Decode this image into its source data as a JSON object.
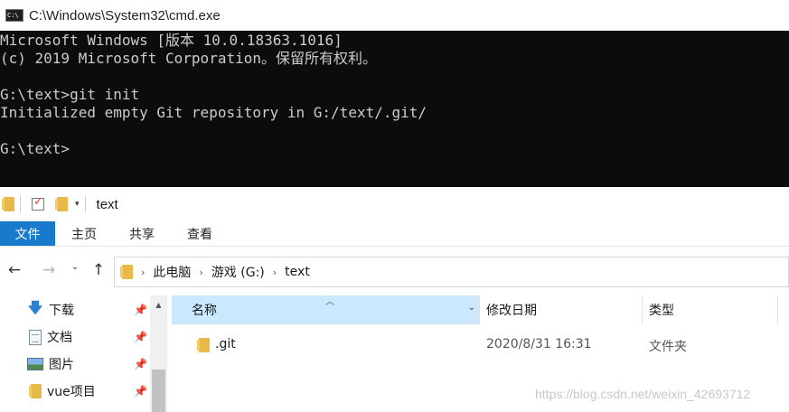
{
  "cmd": {
    "title": "C:\\Windows\\System32\\cmd.exe",
    "lines": [
      "Microsoft Windows [版本 10.0.18363.1016]",
      "(c) 2019 Microsoft Corporation。保留所有权利。",
      "",
      "G:\\text>git init",
      "Initialized empty Git repository in G:/text/.git/",
      "",
      "G:\\text>"
    ]
  },
  "explorer": {
    "window_title": "text",
    "ribbon_tabs": [
      "文件",
      "主页",
      "共享",
      "查看"
    ],
    "breadcrumb": [
      "此电脑",
      "游戏 (G:)",
      "text"
    ],
    "nav_items": [
      {
        "label": "下载",
        "icon": "download-arrow-icon"
      },
      {
        "label": "文档",
        "icon": "document-icon"
      },
      {
        "label": "图片",
        "icon": "pictures-icon"
      },
      {
        "label": "vue项目",
        "icon": "folder-icon"
      }
    ],
    "columns": {
      "name": "名称",
      "date": "修改日期",
      "type": "类型"
    },
    "files": [
      {
        "name": ".git",
        "date": "2020/8/31 16:31",
        "type": "文件夹"
      }
    ],
    "colors": {
      "accent": "#1979ca",
      "selected_header": "#cce8ff",
      "folder": "#e8b84a",
      "console_bg": "#0c0c0c",
      "console_fg": "#cccccc"
    }
  },
  "watermark": "https://blog.csdn.net/weixin_42693712"
}
